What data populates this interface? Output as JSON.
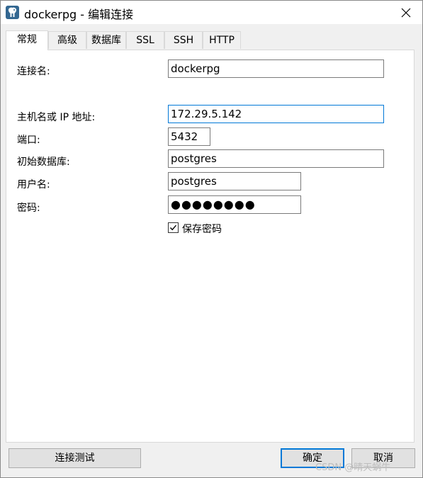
{
  "window": {
    "title": "dockerpg - 编辑连接"
  },
  "tabs": [
    "常规",
    "高级",
    "数据库",
    "SSL",
    "SSH",
    "HTTP"
  ],
  "form": {
    "connection_name_label": "连接名:",
    "connection_name_value": "dockerpg",
    "host_label": "主机名或 IP 地址:",
    "host_value": "172.29.5.142",
    "port_label": "端口:",
    "port_value": "5432",
    "initial_db_label": "初始数据库:",
    "initial_db_value": "postgres",
    "username_label": "用户名:",
    "username_value": "postgres",
    "password_label": "密码:",
    "password_value": "●●●●●●●●",
    "save_password_label": "保存密码",
    "save_password_checked": true
  },
  "buttons": {
    "test": "连接测试",
    "ok": "确定",
    "cancel": "取消"
  },
  "watermark": "CSDN @晴天蜗牛",
  "colors": {
    "accent": "#0078d7",
    "app_icon": "#336791"
  }
}
